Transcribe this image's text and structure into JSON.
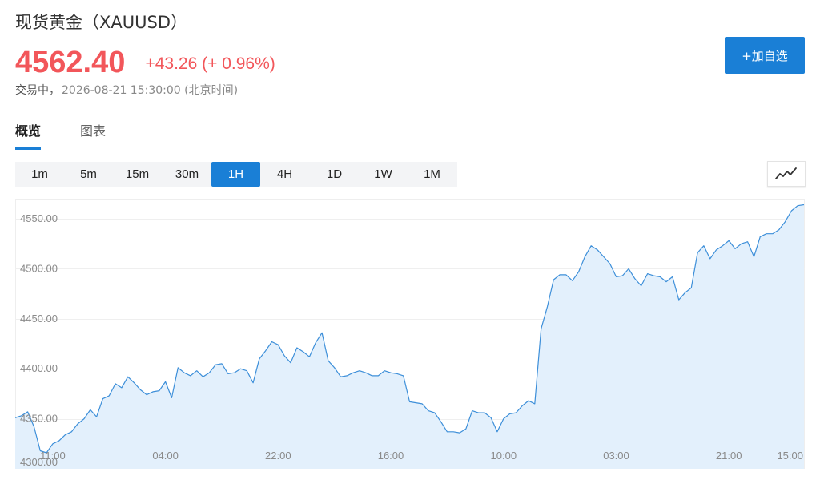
{
  "header": {
    "title": "现货黄金（XAUUSD）",
    "price": "4562.40",
    "change": "+43.26 (+ 0.96%)",
    "status_label": "交易中，",
    "datetime": "2026-08-21 15:30:00 (北京时间)",
    "add_button_label": "+加自选",
    "price_color": "#f2565a",
    "accent_color": "#1a7fd6"
  },
  "tabs": [
    {
      "label": "概览",
      "active": true
    },
    {
      "label": "图表",
      "active": false
    }
  ],
  "periods": [
    {
      "label": "1m",
      "active": false
    },
    {
      "label": "5m",
      "active": false
    },
    {
      "label": "15m",
      "active": false
    },
    {
      "label": "30m",
      "active": false
    },
    {
      "label": "1H",
      "active": true
    },
    {
      "label": "4H",
      "active": false
    },
    {
      "label": "1D",
      "active": false
    },
    {
      "label": "1W",
      "active": false
    },
    {
      "label": "1M",
      "active": false
    }
  ],
  "chart_type_icon": "line-chart-icon",
  "chart_data": {
    "type": "area",
    "ylim": [
      4300,
      4570
    ],
    "yticks": [
      4300,
      4350,
      4400,
      4450,
      4500,
      4550
    ],
    "ytick_labels": [
      "4300.00",
      "4350.00",
      "4400.00",
      "4450.00",
      "4500.00",
      "4550.00"
    ],
    "xtick_labels": [
      "11:00",
      "04:00",
      "22:00",
      "16:00",
      "10:00",
      "03:00",
      "21:00",
      "15:00"
    ],
    "xtick_index": [
      6,
      24,
      42,
      60,
      78,
      96,
      114,
      132
    ],
    "line_color": "#3d8fd9",
    "fill_color": "#e3f0fc",
    "grid": true,
    "series": [
      {
        "values": [
          4351,
          4353,
          4357,
          4342,
          4318,
          4316,
          4325,
          4328,
          4334,
          4337,
          4345,
          4350,
          4359,
          4352,
          4370,
          4373,
          4385,
          4381,
          4392,
          4386,
          4379,
          4374,
          4377,
          4378,
          4387,
          4371,
          4401,
          4396,
          4393,
          4398,
          4392,
          4396,
          4404,
          4405,
          4395,
          4396,
          4400,
          4398,
          4386,
          4410,
          4418,
          4427,
          4424,
          4413,
          4406,
          4421,
          4417,
          4412,
          4426,
          4436,
          4408,
          4401,
          4392,
          4393,
          4396,
          4398,
          4396,
          4393,
          4393,
          4398,
          4396,
          4395,
          4393,
          4367,
          4366,
          4365,
          4358,
          4356,
          4347,
          4337,
          4337,
          4336,
          4340,
          4358,
          4356,
          4356,
          4351,
          4337,
          4350,
          4355,
          4356,
          4363,
          4368,
          4365,
          4440,
          4462,
          4489,
          4494,
          4494,
          4488,
          4497,
          4512,
          4523,
          4519,
          4512,
          4505,
          4492,
          4493,
          4500,
          4490,
          4483,
          4495,
          4493,
          4492,
          4487,
          4492,
          4469,
          4476,
          4481,
          4516,
          4523,
          4510,
          4519,
          4523,
          4528,
          4520,
          4525,
          4527,
          4512,
          4532,
          4535,
          4535,
          4539,
          4547,
          4558,
          4563,
          4564
        ]
      }
    ]
  }
}
